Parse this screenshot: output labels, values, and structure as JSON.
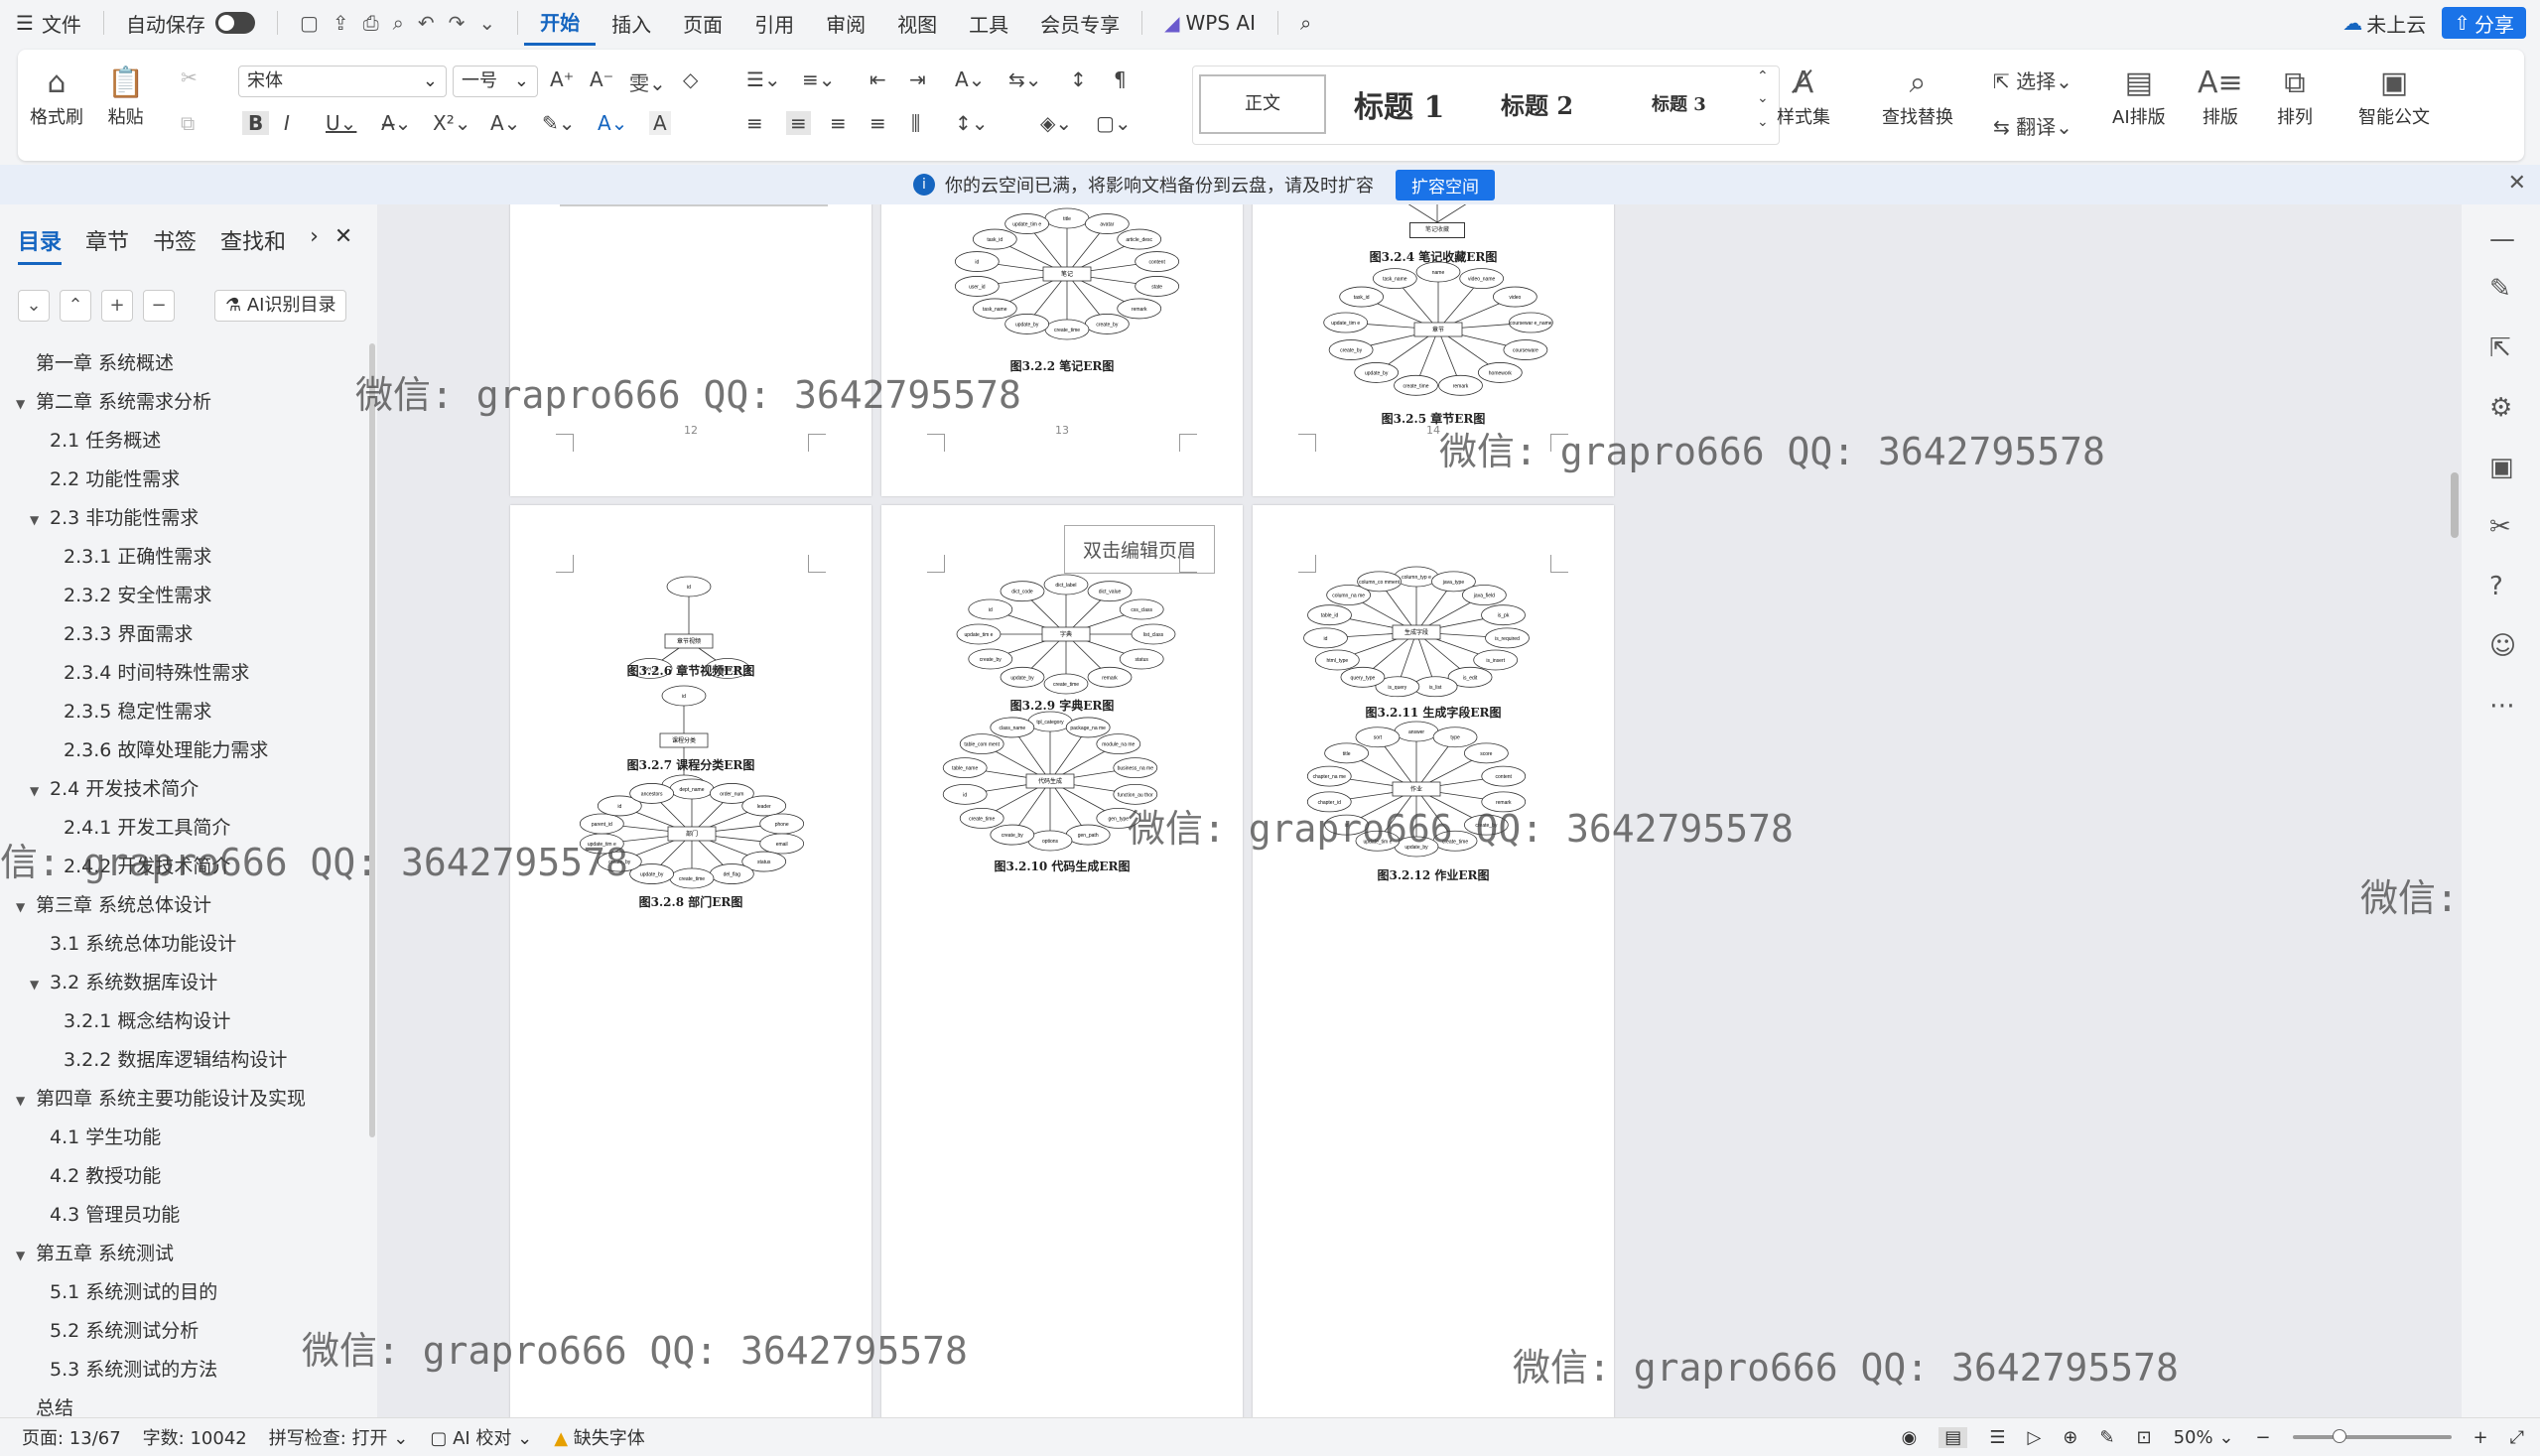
{
  "tabbar": {
    "menu": "文件",
    "autosave": "自动保存",
    "tabs": [
      "开始",
      "插入",
      "页面",
      "引用",
      "审阅",
      "视图",
      "工具",
      "会员专享"
    ],
    "active_tab": "开始",
    "wps_ai": "WPS AI",
    "cloud": "未上云",
    "share": "分享"
  },
  "ribbon": {
    "format_painter": "格式刷",
    "paste": "粘贴",
    "font": "宋体",
    "size": "一号",
    "styles": {
      "normal": "正文",
      "h1": "标题 1",
      "h2": "标题 2",
      "h3": "标题 3",
      "style_set": "样式集"
    },
    "find_replace": "查找替换",
    "select": "选择",
    "translate": "翻译",
    "ai_layout": "AI排版",
    "layout": "排版",
    "arrange": "排列",
    "smart_doc": "智能公文"
  },
  "notice": {
    "text": "你的云空间已满，将影响文档备份到云盘，请及时扩容",
    "button": "扩容空间"
  },
  "nav": {
    "tabs": [
      "目录",
      "章节",
      "书签",
      "查找和"
    ],
    "ai_toc": "AI识别目录",
    "toc": [
      {
        "text": "第一章  系统概述",
        "level": 1,
        "caret": ""
      },
      {
        "text": "第二章  系统需求分析",
        "level": 1,
        "caret": "▼"
      },
      {
        "text": "2.1  任务概述",
        "level": 2,
        "caret": ""
      },
      {
        "text": "2.2  功能性需求",
        "level": 2,
        "caret": ""
      },
      {
        "text": "2.3  非功能性需求",
        "level": 2,
        "caret": "▼"
      },
      {
        "text": "2.3.1 正确性需求",
        "level": 3,
        "caret": ""
      },
      {
        "text": "2.3.2 安全性需求",
        "level": 3,
        "caret": ""
      },
      {
        "text": "2.3.3 界面需求",
        "level": 3,
        "caret": ""
      },
      {
        "text": "2.3.4 时间特殊性需求",
        "level": 3,
        "caret": ""
      },
      {
        "text": "2.3.5 稳定性需求",
        "level": 3,
        "caret": ""
      },
      {
        "text": "2.3.6 故障处理能力需求",
        "level": 3,
        "caret": ""
      },
      {
        "text": "2.4  开发技术简介",
        "level": 2,
        "caret": "▼"
      },
      {
        "text": "2.4.1  开发工具简介",
        "level": 3,
        "caret": ""
      },
      {
        "text": "2.4.2  开发技术简介",
        "level": 3,
        "caret": ""
      },
      {
        "text": "第三章  系统总体设计",
        "level": 1,
        "caret": "▼"
      },
      {
        "text": "3.1  系统总体功能设计",
        "level": 2,
        "caret": ""
      },
      {
        "text": "3.2  系统数据库设计",
        "level": 2,
        "caret": "▼"
      },
      {
        "text": "3.2.1  概念结构设计",
        "level": 3,
        "caret": ""
      },
      {
        "text": "3.2.2  数据库逻辑结构设计",
        "level": 3,
        "caret": ""
      },
      {
        "text": "第四章  系统主要功能设计及实现",
        "level": 1,
        "caret": "▼"
      },
      {
        "text": "4.1  学生功能",
        "level": 2,
        "caret": ""
      },
      {
        "text": "4.2 教授功能",
        "level": 2,
        "caret": ""
      },
      {
        "text": "4.3 管理员功能",
        "level": 2,
        "caret": ""
      },
      {
        "text": "第五章  系统测试",
        "level": 1,
        "caret": "▼"
      },
      {
        "text": "5.1  系统测试的目的",
        "level": 2,
        "caret": ""
      },
      {
        "text": "5.2  系统测试分析",
        "level": 2,
        "caret": ""
      },
      {
        "text": "5.3  系统测试的方法",
        "level": 2,
        "caret": ""
      },
      {
        "text": "总结",
        "level": 1,
        "caret": ""
      }
    ]
  },
  "pages": {
    "p12": {
      "num": "12"
    },
    "p13": {
      "num": "13",
      "caption": "图3.2.2 笔记ER图",
      "center": "笔记",
      "attrs": [
        "title",
        "avatar",
        "article_desc",
        "content",
        "state",
        "remark",
        "create_by",
        "create_time",
        "update_by",
        "task_name",
        "user_id",
        "id",
        "task_id",
        "update_tim e"
      ]
    },
    "p14": {
      "num": "14",
      "caption_top": "图3.2.4 笔记收藏ER图",
      "top_box": "笔记收藏",
      "caption": "图3.2.5 章节ER图",
      "center": "章节",
      "attrs": [
        "name",
        "video_name",
        "video",
        "coursewar e_name",
        "courseware",
        "homework",
        "remark",
        "create_time",
        "update_by",
        "create_by",
        "update_tim e",
        "task_id",
        "task_name"
      ]
    },
    "p15": {
      "caption_a": "图3.2.6 章节视频ER图",
      "center_a": "章节视频",
      "attrs_a": [
        "id",
        "chapter_id",
        "user_id"
      ],
      "caption_b": "图3.2.7 课程分类ER图",
      "center_b": "课程分类",
      "attrs_b": [
        "id",
        "name"
      ],
      "caption_c": "图3.2.8 部门ER图",
      "center_c": "部门",
      "attrs_c": [
        "dept_name",
        "order_num",
        "leader",
        "phone",
        "email",
        "status",
        "del_flag",
        "create_time",
        "update_by",
        "create_by",
        "update_tim e",
        "parent_id",
        "id",
        "ancestors"
      ]
    },
    "p16": {
      "header": "双击编辑页眉",
      "caption_a": "图3.2.9 字典ER图",
      "center_a": "字典",
      "attrs_a": [
        "dict_label",
        "dict_value",
        "css_class",
        "list_class",
        "status",
        "remark",
        "create_time",
        "update_by",
        "create_by",
        "update_tim e",
        "id",
        "dict_code"
      ],
      "caption_b": "图3.2.10 代码生成ER图",
      "center_b": "代码生成",
      "attrs_b": [
        "tpl_category",
        "package_na me",
        "module_na me",
        "business_na me",
        "function_au thor",
        "gen_type",
        "gen_path",
        "options",
        "create_by",
        "create_time",
        "id",
        "table_name",
        "table_com ment",
        "class_name"
      ]
    },
    "p17": {
      "caption_a": "图3.2.11 生成字段ER图",
      "center_a": "生成字段",
      "attrs_a": [
        "column_typ e",
        "java_type",
        "java_field",
        "is_pk",
        "is_required",
        "is_insert",
        "is_edit",
        "is_list",
        "is_query",
        "query_type",
        "html_type",
        "id",
        "table_id",
        "column_na me",
        "column_co mment"
      ],
      "caption_b": "图3.2.12 作业ER图",
      "center_b": "作业",
      "attrs_b": [
        "answer",
        "type",
        "score",
        "content",
        "remark",
        "create_by",
        "create_time",
        "update_by",
        "update_tim e",
        "id",
        "chapter_id",
        "chapter_na me",
        "title",
        "sort"
      ]
    }
  },
  "watermark": "微信: grapro666 QQ: 3642795578",
  "watermark_cut_left": "信: grapro666 QQ: 3642795578",
  "watermark_cut_right": "微信: gra",
  "status": {
    "page": "页面: 13/67",
    "words": "字数: 10042",
    "spell": "拼写检查: 打开",
    "proof": "AI 校对",
    "missing_font": "缺失字体",
    "zoom": "50%"
  }
}
